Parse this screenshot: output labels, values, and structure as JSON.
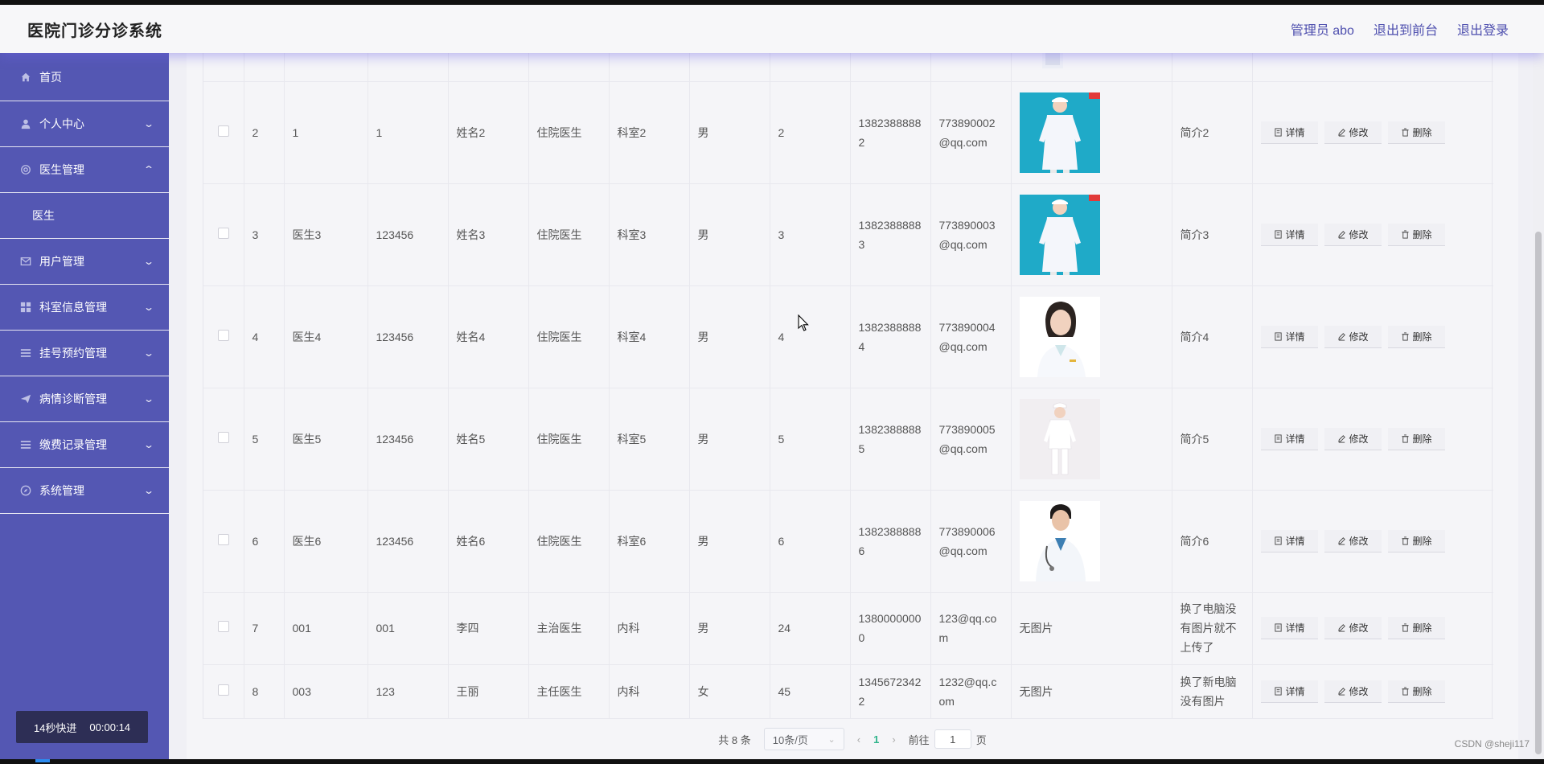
{
  "header": {
    "title": "医院门诊分诊系统",
    "links": [
      "管理员 abo",
      "退出到前台",
      "退出登录"
    ]
  },
  "sidebar": {
    "items": [
      {
        "label": "首页",
        "icon": "home-icon",
        "has_arrow": false,
        "arrow": ""
      },
      {
        "label": "个人中心",
        "icon": "user-icon",
        "has_arrow": true,
        "arrow": "⌄"
      },
      {
        "label": "医生管理",
        "icon": "help-icon",
        "has_arrow": true,
        "arrow": "⌃"
      },
      {
        "label": "医生",
        "submenu": true
      },
      {
        "label": "用户管理",
        "icon": "message-icon",
        "has_arrow": true,
        "arrow": "⌄"
      },
      {
        "label": "科室信息管理",
        "icon": "grid-icon",
        "has_arrow": true,
        "arrow": "⌄"
      },
      {
        "label": "挂号预约管理",
        "icon": "menu-icon",
        "has_arrow": true,
        "arrow": "⌄"
      },
      {
        "label": "病情诊断管理",
        "icon": "send-icon",
        "has_arrow": true,
        "arrow": "⌄"
      },
      {
        "label": "缴费记录管理",
        "icon": "menu-icon",
        "has_arrow": true,
        "arrow": "⌄"
      },
      {
        "label": "系统管理",
        "icon": "compass-icon",
        "has_arrow": true,
        "arrow": "⌄"
      }
    ],
    "speed_badge": {
      "label": "14秒快进",
      "time": "00:00:14"
    }
  },
  "table": {
    "rows": [
      {
        "no": "2",
        "account": "1",
        "password": "1",
        "name": "姓名2",
        "title": "住院医生",
        "dept": "科室2",
        "gender": "男",
        "age": "2",
        "phone": "13823888882",
        "email": "773890002@qq.com",
        "photo": "nurse-teal",
        "intro": "简介2"
      },
      {
        "no": "3",
        "account": "医生3",
        "password": "123456",
        "name": "姓名3",
        "title": "住院医生",
        "dept": "科室3",
        "gender": "男",
        "age": "3",
        "phone": "13823888883",
        "email": "773890003@qq.com",
        "photo": "nurse-teal",
        "intro": "简介3"
      },
      {
        "no": "4",
        "account": "医生4",
        "password": "123456",
        "name": "姓名4",
        "title": "住院医生",
        "dept": "科室4",
        "gender": "男",
        "age": "4",
        "phone": "13823888884",
        "email": "773890004@qq.com",
        "photo": "doctor-woman",
        "intro": "简介4"
      },
      {
        "no": "5",
        "account": "医生5",
        "password": "123456",
        "name": "姓名5",
        "title": "住院医生",
        "dept": "科室5",
        "gender": "男",
        "age": "5",
        "phone": "13823888885",
        "email": "773890005@qq.com",
        "photo": "nurse-white",
        "intro": "简介5"
      },
      {
        "no": "6",
        "account": "医生6",
        "password": "123456",
        "name": "姓名6",
        "title": "住院医生",
        "dept": "科室6",
        "gender": "男",
        "age": "6",
        "phone": "13823888886",
        "email": "773890006@qq.com",
        "photo": "doctor-man",
        "intro": "简介6"
      },
      {
        "no": "7",
        "account": "001",
        "password": "001",
        "name": "李四",
        "title": "主治医生",
        "dept": "内科",
        "gender": "男",
        "age": "24",
        "phone": "13800000000",
        "email": "123@qq.com",
        "photo": "",
        "no_photo": "无图片",
        "intro": "换了电脑没有图片就不上传了"
      },
      {
        "no": "8",
        "account": "003",
        "password": "123",
        "name": "王丽",
        "title": "主任医生",
        "dept": "内科",
        "gender": "女",
        "age": "45",
        "phone": "13456723422",
        "email": "1232@qq.com",
        "photo": "",
        "no_photo": "无图片",
        "intro": "换了新电脑没有图片"
      }
    ],
    "actions": {
      "detail": "详情",
      "edit": "修改",
      "delete": "删除"
    }
  },
  "pagination": {
    "total": "共 8 条",
    "page_size": "10条/页",
    "current_page": "1",
    "goto_label": "前往",
    "goto_value": "1",
    "page_suffix": "页"
  },
  "watermark": "CSDN @sheji117",
  "colors": {
    "sidebar": "#5457b3",
    "accent": "#4e4fae",
    "active_page": "#2fb48a"
  }
}
